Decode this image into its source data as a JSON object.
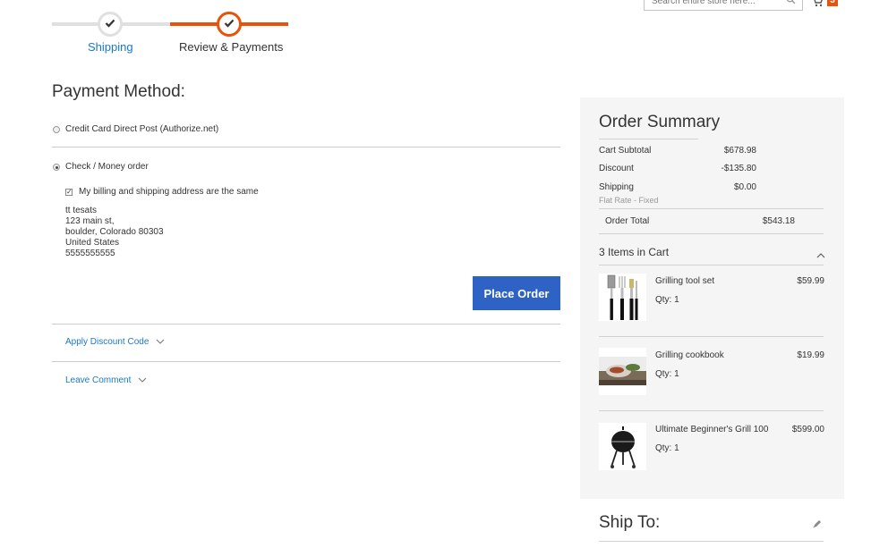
{
  "header": {
    "search_placeholder": "Search entire store here...",
    "cart_count": "3"
  },
  "progress": {
    "steps": [
      {
        "label": "Shipping",
        "state": "complete"
      },
      {
        "label": "Review & Payments",
        "state": "active"
      }
    ]
  },
  "payment": {
    "title": "Payment Method:",
    "options": [
      {
        "label": "Credit Card Direct Post (Authorize.net)",
        "selected": false
      },
      {
        "label": "Check / Money order",
        "selected": true
      }
    ],
    "same_address_label": "My billing and shipping address are the same",
    "same_address_checked": true,
    "address_lines": [
      "tt tesats",
      "123 main st,",
      "boulder, Colorado 80303",
      "United States",
      "5555555555"
    ],
    "place_order_label": "Place Order",
    "discount_link": "Apply Discount Code",
    "comment_link": "Leave Comment"
  },
  "summary": {
    "title": "Order Summary",
    "rows": [
      {
        "label": "Cart Subtotal",
        "value": "$678.98"
      },
      {
        "label": "Discount",
        "value": "-$135.80"
      },
      {
        "label": "Shipping",
        "value": "$0.00",
        "sub": "Flat Rate - Fixed"
      }
    ],
    "total_label": "Order Total",
    "total_value": "$543.18",
    "items_title": "3 Items in Cart",
    "items": [
      {
        "name": "Grilling tool set",
        "qty": "Qty: 1",
        "price": "$59.99"
      },
      {
        "name": "Grilling cookbook",
        "qty": "Qty: 1",
        "price": "$19.99"
      },
      {
        "name": "Ultimate Beginner's Grill 100",
        "qty": "Qty: 1",
        "price": "$599.00"
      }
    ]
  },
  "ship_to": {
    "title": "Ship To:"
  },
  "colors": {
    "accent": "#e8520a",
    "link": "#1979c3",
    "button": "#2e62c4"
  }
}
